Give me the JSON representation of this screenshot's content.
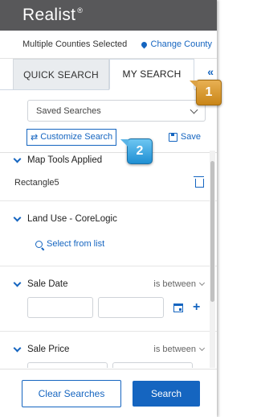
{
  "brand": {
    "name": "Realist",
    "mark": "®"
  },
  "county": {
    "status": "Multiple Counties Selected",
    "change_label": "Change County"
  },
  "tabs": [
    {
      "label": "QUICK SEARCH"
    },
    {
      "label": "MY SEARCH"
    }
  ],
  "collapse_glyph": "«",
  "saved_searches": {
    "selected": "Saved Searches"
  },
  "customize_label": "Customize Search",
  "save_label": "Save",
  "sections": {
    "map_tools": {
      "title": "Map Tools Applied",
      "item": "Rectangle5"
    },
    "land_use": {
      "title": "Land Use - CoreLogic",
      "link": "Select from list"
    },
    "sale_date": {
      "title": "Sale Date",
      "operator": "is between"
    },
    "sale_price": {
      "title": "Sale Price",
      "operator": "is between"
    }
  },
  "footer": {
    "clear_label": "Clear Searches",
    "search_label": "Search"
  },
  "callouts": {
    "one": "1",
    "two": "2"
  },
  "colors": {
    "accent": "#1565c0",
    "header_bg": "#58585a",
    "callout_one": "#d9992e",
    "callout_two": "#3aa6e0"
  }
}
